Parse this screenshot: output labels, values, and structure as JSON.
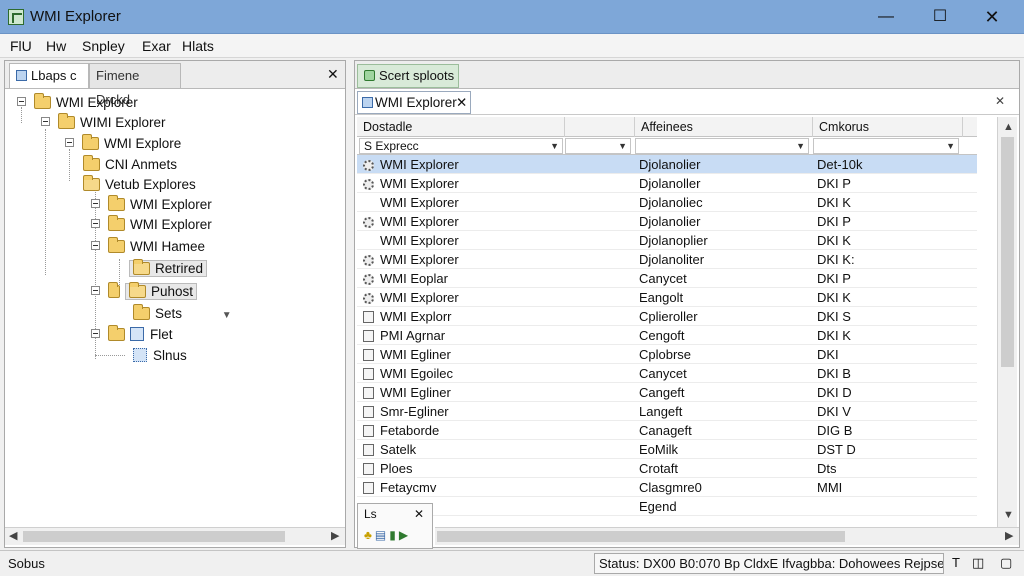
{
  "window": {
    "title": "WMI Explorer",
    "minimize": "—",
    "maximize": "☐",
    "close": "✕"
  },
  "menu": [
    "FlU",
    "Hw",
    "Snpley",
    "Exar",
    "Hlats"
  ],
  "left_pane": {
    "tabs": [
      "Lbaps c",
      "Fimene Drckd"
    ],
    "close": "✕",
    "tree": [
      {
        "label": "WMI Explorer"
      },
      {
        "label": "WIMI Explorer"
      },
      {
        "label": "WMI Explore"
      },
      {
        "label": "CNI Anmets"
      },
      {
        "label": "Vetub Explores"
      },
      {
        "label": "WMI Explorer"
      },
      {
        "label": "WMI Explorer"
      },
      {
        "label": "WMI Hamee"
      },
      {
        "label": "Retrired"
      },
      {
        "label": "Puhost"
      },
      {
        "label": "Sets"
      },
      {
        "label": "Flet"
      },
      {
        "label": "Slnus"
      }
    ],
    "sets_arrow": "▼"
  },
  "right_pane": {
    "tab": "Scert sploots",
    "doc_tab": "WMI Explorer",
    "doc_tab_close": "✕",
    "doc_bar_close": "✕",
    "columns": [
      "Dostadle",
      "Affeinees",
      "Cmkorus"
    ],
    "filter": "S Exprecc",
    "rows": [
      {
        "name": "WMI Explorer",
        "col2": "Djolanolier",
        "col3": "Det-10k",
        "icon": "gear"
      },
      {
        "name": "WMI Explorer",
        "col2": "Djolanoller",
        "col3": "DKI P",
        "icon": "gear"
      },
      {
        "name": "WMI Explorer",
        "col2": "Djolanoliec",
        "col3": "DKI K",
        "icon": "none"
      },
      {
        "name": "WMI Explorer",
        "col2": "Djolanolier",
        "col3": "DKI P",
        "icon": "gear"
      },
      {
        "name": "WMI Explorer",
        "col2": "Djolanoplier",
        "col3": "DKI K",
        "icon": "none"
      },
      {
        "name": "WMI Explorer",
        "col2": "Djolanoliter",
        "col3": "DKI K:",
        "icon": "gear"
      },
      {
        "name": "WMI Eoplar",
        "col2": "Canycet",
        "col3": "DKI P",
        "icon": "gear"
      },
      {
        "name": "WMI Explorer",
        "col2": "Eangolt",
        "col3": "DKI K",
        "icon": "gear"
      },
      {
        "name": "WMI Explorr",
        "col2": "Cplieroller",
        "col3": "DKI S",
        "icon": "box"
      },
      {
        "name": "PMI Agrnar",
        "col2": "Cengoft",
        "col3": "DKI K",
        "icon": "box"
      },
      {
        "name": "WMI Egliner",
        "col2": "Cplobrse",
        "col3": "DKI",
        "icon": "box"
      },
      {
        "name": "WMI Egoilec",
        "col2": "Canycet",
        "col3": "DKI B",
        "icon": "box"
      },
      {
        "name": "WMI Egliner",
        "col2": "Cangeft",
        "col3": "DKI D",
        "icon": "box"
      },
      {
        "name": "Smr-Egliner",
        "col2": "Langeft",
        "col3": "DKI V",
        "icon": "box"
      },
      {
        "name": "Fetaborde",
        "col2": "Canageft",
        "col3": "DIG B",
        "icon": "box"
      },
      {
        "name": "Satelk",
        "col2": "EoMilk",
        "col3": "DST D",
        "icon": "box"
      },
      {
        "name": "Ploes",
        "col2": "Crotaft",
        "col3": "Dts",
        "icon": "box"
      },
      {
        "name": "Fetaycmv",
        "col2": "Clasgmre0",
        "col3": "MMI",
        "icon": "box"
      },
      {
        "name": "",
        "col2": "Egend",
        "col3": "",
        "icon": "none"
      }
    ],
    "mini_panel": {
      "title": "Ls",
      "close": "✕"
    }
  },
  "status": {
    "left": "Sobus",
    "right": "Status: DX00 B0:070 Bp CldxE Ifvagbba: Dohowees Rejpsecc"
  },
  "colors": {
    "titlebar": "#7ea7d8",
    "selection": "#c8dcf4",
    "folder": "#f4cf6c"
  }
}
